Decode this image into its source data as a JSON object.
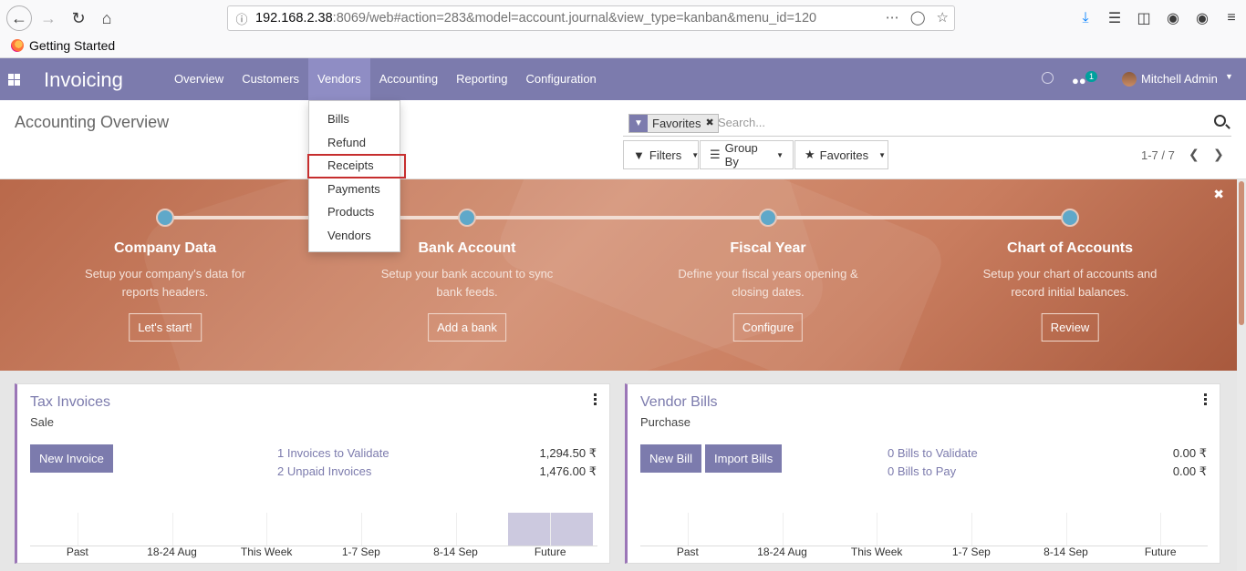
{
  "browser": {
    "url_host": "192.168.2.38",
    "url_rest": ":8069/web#action=283&model=account.journal&view_type=kanban&menu_id=120",
    "bookmark": "Getting Started"
  },
  "navbar": {
    "app_title": "Invoicing",
    "menu": [
      "Overview",
      "Customers",
      "Vendors",
      "Accounting",
      "Reporting",
      "Configuration"
    ],
    "active_menu": "Vendors",
    "chat_count": "1",
    "user": "Mitchell Admin"
  },
  "vendors_menu": {
    "items": [
      "Bills",
      "Refund",
      "Receipts",
      "Payments",
      "Products",
      "Vendors"
    ],
    "highlighted": "Receipts"
  },
  "control_panel": {
    "breadcrumb": "Accounting Overview",
    "facet": "Favorites",
    "search_placeholder": "Search...",
    "filters": "Filters",
    "group_by": "Group By",
    "favorites": "Favorites",
    "pager": "1-7 / 7"
  },
  "onboarding": {
    "steps": [
      {
        "title": "Company Data",
        "desc": "Setup your company's data for reports headers.",
        "button": "Let's start!"
      },
      {
        "title": "Bank Account",
        "desc": "Setup your bank account to sync bank feeds.",
        "button": "Add a bank"
      },
      {
        "title": "Fiscal Year",
        "desc": "Define your fiscal years opening & closing dates.",
        "button": "Configure"
      },
      {
        "title": "Chart of Accounts",
        "desc": "Setup your chart of accounts and record initial balances.",
        "button": "Review"
      }
    ]
  },
  "cards": [
    {
      "title": "Tax Invoices",
      "subtitle": "Sale",
      "buttons": [
        "New Invoice"
      ],
      "lines": [
        {
          "label": "1 Invoices to Validate",
          "amount": "1,294.50 ₹"
        },
        {
          "label": "2 Unpaid Invoices",
          "amount": "1,476.00 ₹"
        }
      ],
      "graph_labels": [
        "Past",
        "18-24 Aug",
        "This Week",
        "1-7 Sep",
        "8-14 Sep",
        "Future"
      ],
      "graph_values": [
        0,
        0,
        0,
        0,
        0,
        1
      ]
    },
    {
      "title": "Vendor Bills",
      "subtitle": "Purchase",
      "buttons": [
        "New Bill",
        "Import Bills"
      ],
      "lines": [
        {
          "label": "0 Bills to Validate",
          "amount": "0.00 ₹"
        },
        {
          "label": "0 Bills to Pay",
          "amount": "0.00 ₹"
        }
      ],
      "graph_labels": [
        "Past",
        "18-24 Aug",
        "This Week",
        "1-7 Sep",
        "8-14 Sep",
        "Future"
      ],
      "graph_values": [
        0,
        0,
        0,
        0,
        0,
        0
      ]
    }
  ]
}
